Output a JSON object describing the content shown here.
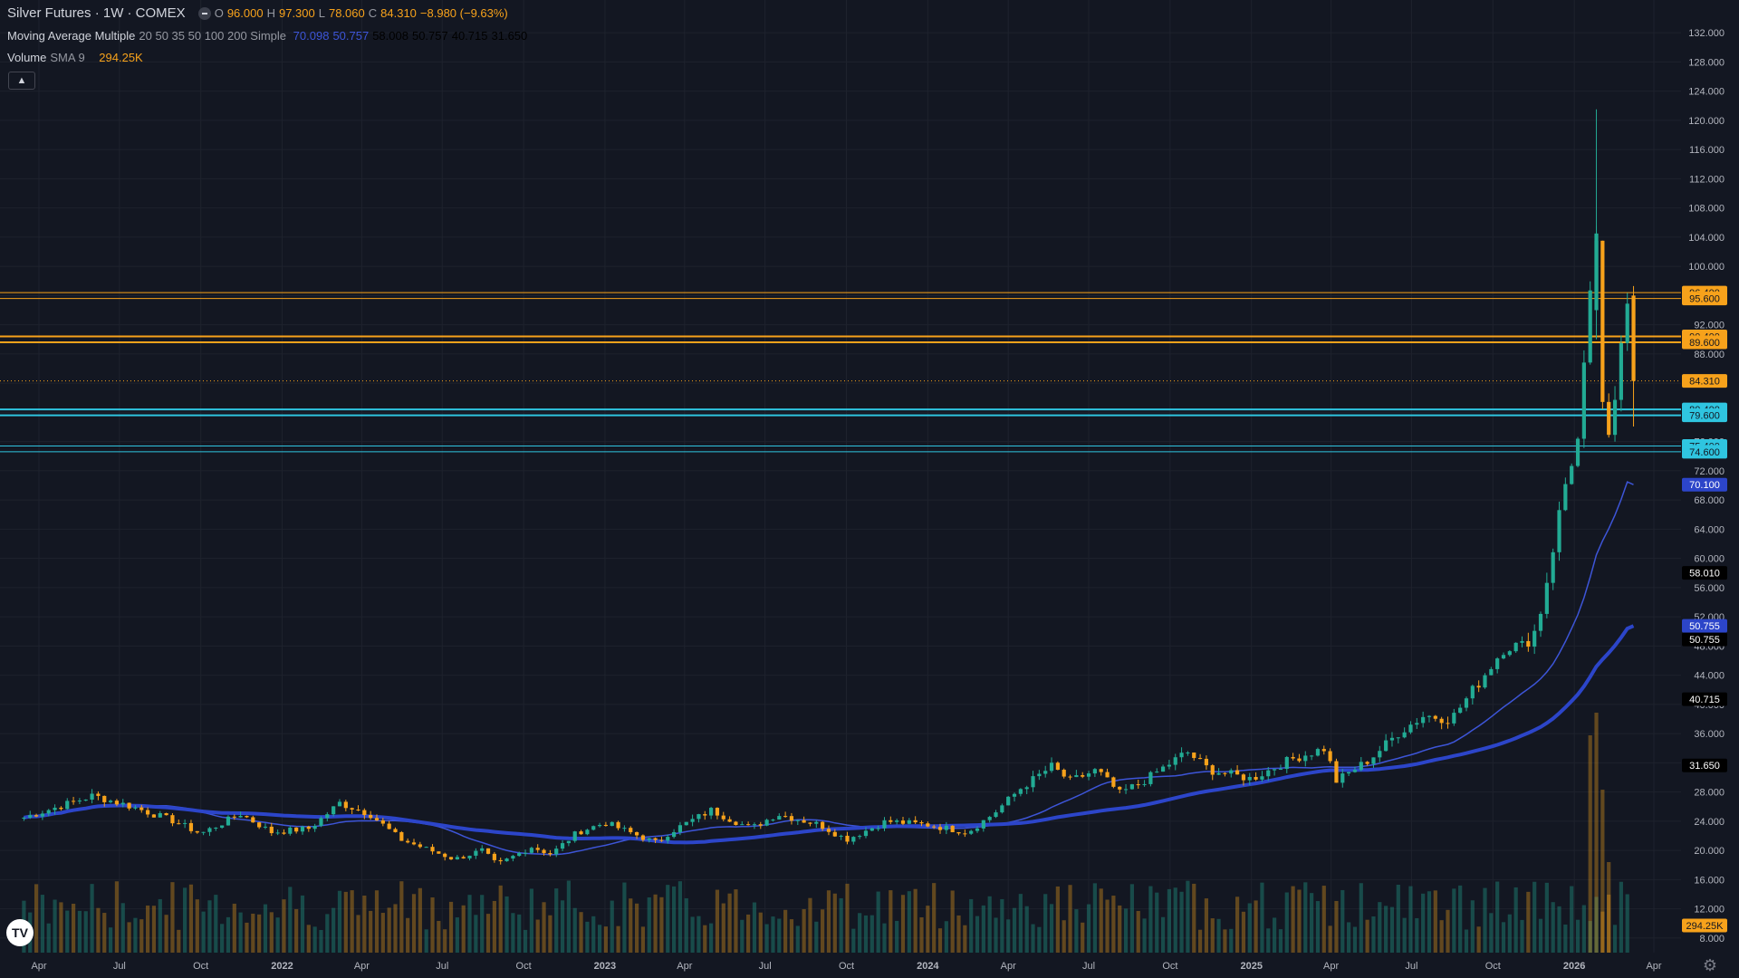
{
  "header": {
    "symbol": "Silver Futures · 1W · COMEX",
    "open_label": "O",
    "open": "96.000",
    "high_label": "H",
    "high": "97.300",
    "low_label": "L",
    "low": "78.060",
    "close_label": "C",
    "close": "84.310",
    "change": "−8.980 (−9.63%)"
  },
  "ma_legend": {
    "name": "Moving Average Multiple",
    "params": "20 50 35 50 100 200 Simple",
    "values": [
      "70.098",
      "50.757",
      "58.008",
      "50.757",
      "40.715",
      "31.650"
    ]
  },
  "volume_legend": {
    "name": "Volume",
    "params": "SMA 9",
    "value": "294.25K"
  },
  "colors": {
    "up": "#22ab94",
    "down": "#f7a21b",
    "ma_thin": "#3d55d8",
    "ma_thick": "#2c45c9",
    "level_orange": "#f7a21b",
    "level_cyan": "#2fc5e0"
  },
  "chart_data": {
    "type": "candlestick",
    "timeframe": "1W",
    "ylim": [
      6,
      134
    ],
    "price_ticks": [
      "132.000",
      "128.000",
      "124.000",
      "120.000",
      "116.000",
      "112.000",
      "108.000",
      "104.000",
      "100.000",
      "96.000",
      "92.000",
      "88.000",
      "84.000",
      "80.000",
      "76.000",
      "72.000",
      "68.000",
      "64.000",
      "60.000",
      "56.000",
      "52.000",
      "48.000",
      "44.000",
      "40.000",
      "36.000",
      "32.000",
      "28.000",
      "24.000",
      "20.000",
      "16.000",
      "12.000",
      "8.000"
    ],
    "time_ticks": [
      {
        "label": "Apr",
        "date": "2021-04-01"
      },
      {
        "label": "Jul",
        "date": "2021-07-01"
      },
      {
        "label": "Oct",
        "date": "2021-10-01"
      },
      {
        "label": "2022",
        "date": "2022-01-01"
      },
      {
        "label": "Apr",
        "date": "2022-04-01"
      },
      {
        "label": "Jul",
        "date": "2022-07-01"
      },
      {
        "label": "Oct",
        "date": "2022-10-01"
      },
      {
        "label": "2023",
        "date": "2023-01-01"
      },
      {
        "label": "Apr",
        "date": "2023-04-01"
      },
      {
        "label": "Jul",
        "date": "2023-07-01"
      },
      {
        "label": "Oct",
        "date": "2023-10-01"
      },
      {
        "label": "2024",
        "date": "2024-01-01"
      },
      {
        "label": "Apr",
        "date": "2024-04-01"
      },
      {
        "label": "Jul",
        "date": "2024-07-01"
      },
      {
        "label": "Oct",
        "date": "2024-10-01"
      },
      {
        "label": "2025",
        "date": "2025-01-01"
      },
      {
        "label": "Apr",
        "date": "2025-04-01"
      },
      {
        "label": "Jul",
        "date": "2025-07-01"
      },
      {
        "label": "Oct",
        "date": "2025-10-01"
      },
      {
        "label": "2026",
        "date": "2026-01-01"
      },
      {
        "label": "Apr",
        "date": "2026-04-01"
      }
    ],
    "levels": [
      {
        "price": 96.4,
        "label": "96.400",
        "color": "#f7a21b"
      },
      {
        "price": 95.6,
        "label": "95.600",
        "color": "#f7a21b"
      },
      {
        "price": 90.4,
        "label": "90.400",
        "color": "#f7a21b"
      },
      {
        "price": 89.6,
        "label": "89.600",
        "color": "#f7a21b"
      },
      {
        "price": 80.4,
        "label": "80.400",
        "color": "#2fc5e0"
      },
      {
        "price": 79.6,
        "label": "79.600",
        "color": "#2fc5e0"
      },
      {
        "price": 75.4,
        "label": "75.400",
        "color": "#2fc5e0"
      },
      {
        "price": 74.6,
        "label": "74.600",
        "color": "#2fc5e0"
      }
    ],
    "last_price": {
      "price": 84.31,
      "label": "84.310"
    },
    "ma_labels": [
      {
        "price": 70.1,
        "label": "70.100",
        "style": "blue"
      },
      {
        "price": 58.01,
        "label": "58.010",
        "style": "black"
      },
      {
        "price": 50.755,
        "label": "50.755",
        "style": "blue"
      },
      {
        "price": 50.755,
        "label": "50.755",
        "style": "black"
      },
      {
        "price": 40.715,
        "label": "40.715",
        "style": "black"
      },
      {
        "price": 31.65,
        "label": "31.650",
        "style": "black"
      }
    ],
    "volume_label": "294.25K",
    "anchors": [
      [
        "2021-03-15",
        24.5
      ],
      [
        "2021-06-01",
        27.5
      ],
      [
        "2021-07-15",
        26
      ],
      [
        "2021-09-01",
        24
      ],
      [
        "2021-10-01",
        22.3
      ],
      [
        "2021-11-15",
        25
      ],
      [
        "2021-12-20",
        22.5
      ],
      [
        "2022-02-01",
        23
      ],
      [
        "2022-03-07",
        26.5
      ],
      [
        "2022-04-10",
        25
      ],
      [
        "2022-05-15",
        21.5
      ],
      [
        "2022-07-15",
        18.8
      ],
      [
        "2022-08-15",
        20
      ],
      [
        "2022-09-01",
        18
      ],
      [
        "2022-10-10",
        20.5
      ],
      [
        "2022-11-01",
        19.5
      ],
      [
        "2022-12-01",
        22.5
      ],
      [
        "2023-01-01",
        23.8
      ],
      [
        "2023-03-01",
        21
      ],
      [
        "2023-03-15",
        22.5
      ],
      [
        "2023-05-01",
        25.5
      ],
      [
        "2023-06-15",
        23
      ],
      [
        "2023-07-15",
        25
      ],
      [
        "2023-09-01",
        23.5
      ],
      [
        "2023-10-01",
        21.5
      ],
      [
        "2023-11-15",
        24
      ],
      [
        "2024-01-01",
        23.5
      ],
      [
        "2024-02-15",
        22.5
      ],
      [
        "2024-03-15",
        25
      ],
      [
        "2024-04-15",
        28.5
      ],
      [
        "2024-05-20",
        31.5
      ],
      [
        "2024-06-10",
        29.5
      ],
      [
        "2024-07-10",
        31
      ],
      [
        "2024-08-05",
        27.8
      ],
      [
        "2024-09-01",
        29.5
      ],
      [
        "2024-10-20",
        33.5
      ],
      [
        "2024-11-15",
        31
      ],
      [
        "2025-01-01",
        29.8
      ],
      [
        "2025-02-15",
        32.5
      ],
      [
        "2025-03-25",
        34
      ],
      [
        "2025-04-07",
        29.5
      ],
      [
        "2025-05-15",
        32.5
      ],
      [
        "2025-06-15",
        36
      ],
      [
        "2025-07-15",
        38.5
      ],
      [
        "2025-08-15",
        38
      ],
      [
        "2025-09-15",
        43
      ],
      [
        "2025-10-15",
        48
      ],
      [
        "2025-11-05",
        48
      ],
      [
        "2025-11-20",
        50.5
      ],
      [
        "2025-12-01",
        57
      ],
      [
        "2025-12-15",
        66
      ],
      [
        "2025-12-25",
        72
      ],
      [
        "2026-01-05",
        76
      ],
      [
        "2026-01-19",
        95
      ],
      [
        "2026-01-26",
        104
      ],
      [
        "2026-02-02",
        80
      ],
      [
        "2026-02-09",
        76
      ],
      [
        "2026-02-16",
        82
      ],
      [
        "2026-02-23",
        91
      ],
      [
        "2026-03-02",
        96
      ]
    ],
    "last_candle": {
      "date": "2026-03-09",
      "open": 96.0,
      "high": 97.3,
      "low": 78.06,
      "close": 84.31
    },
    "spike_candle": {
      "date": "2026-01-26",
      "open": 94.0,
      "high": 121.5,
      "low": 90.0,
      "close": 104.5
    },
    "ma_20_end": 70.1,
    "ma_50_end": 50.755
  }
}
